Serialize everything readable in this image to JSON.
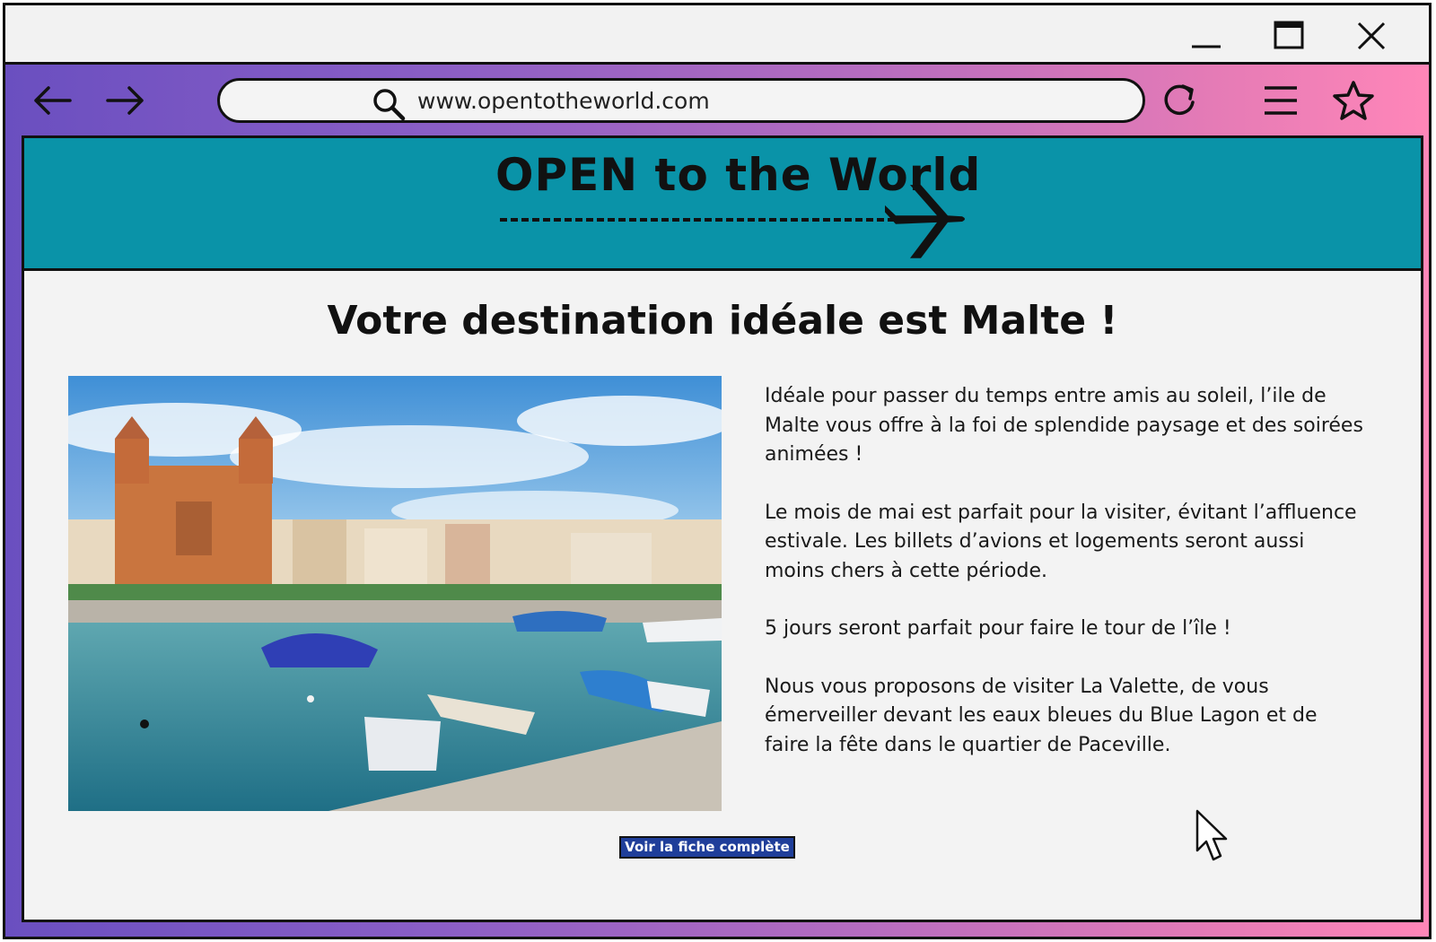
{
  "browser": {
    "url": "www.opentotheworld.com",
    "window_controls": [
      "minimize",
      "maximize",
      "close"
    ],
    "icons": [
      "back-arrow-icon",
      "forward-arrow-icon",
      "search-icon",
      "reload-icon",
      "menu-icon",
      "star-icon"
    ]
  },
  "site": {
    "brand": "OPEN to the World",
    "banner_color": "#0a93a8"
  },
  "main": {
    "heading": "Votre destination idéale est Malte !",
    "paragraphs": [
      "Idéale pour passer du temps entre amis au soleil, l’ile de Malte vous offre à la foi de splendide paysage et des soirées animées !",
      "Le mois de mai est parfait pour la visiter, évitant l’affluence estivale. Les billets d’avions et logements seront aussi moins chers à cette période.",
      "5 jours seront parfait pour faire le tour de l’île !",
      "Nous vous proposons de visiter La Valette, de vous émerveiller devant les eaux bleues du Blue Lagon et de faire la fête dans le quartier de Paceville."
    ],
    "cta_label": "Voir la fiche complète",
    "cta_color": "#1f3e9a"
  }
}
